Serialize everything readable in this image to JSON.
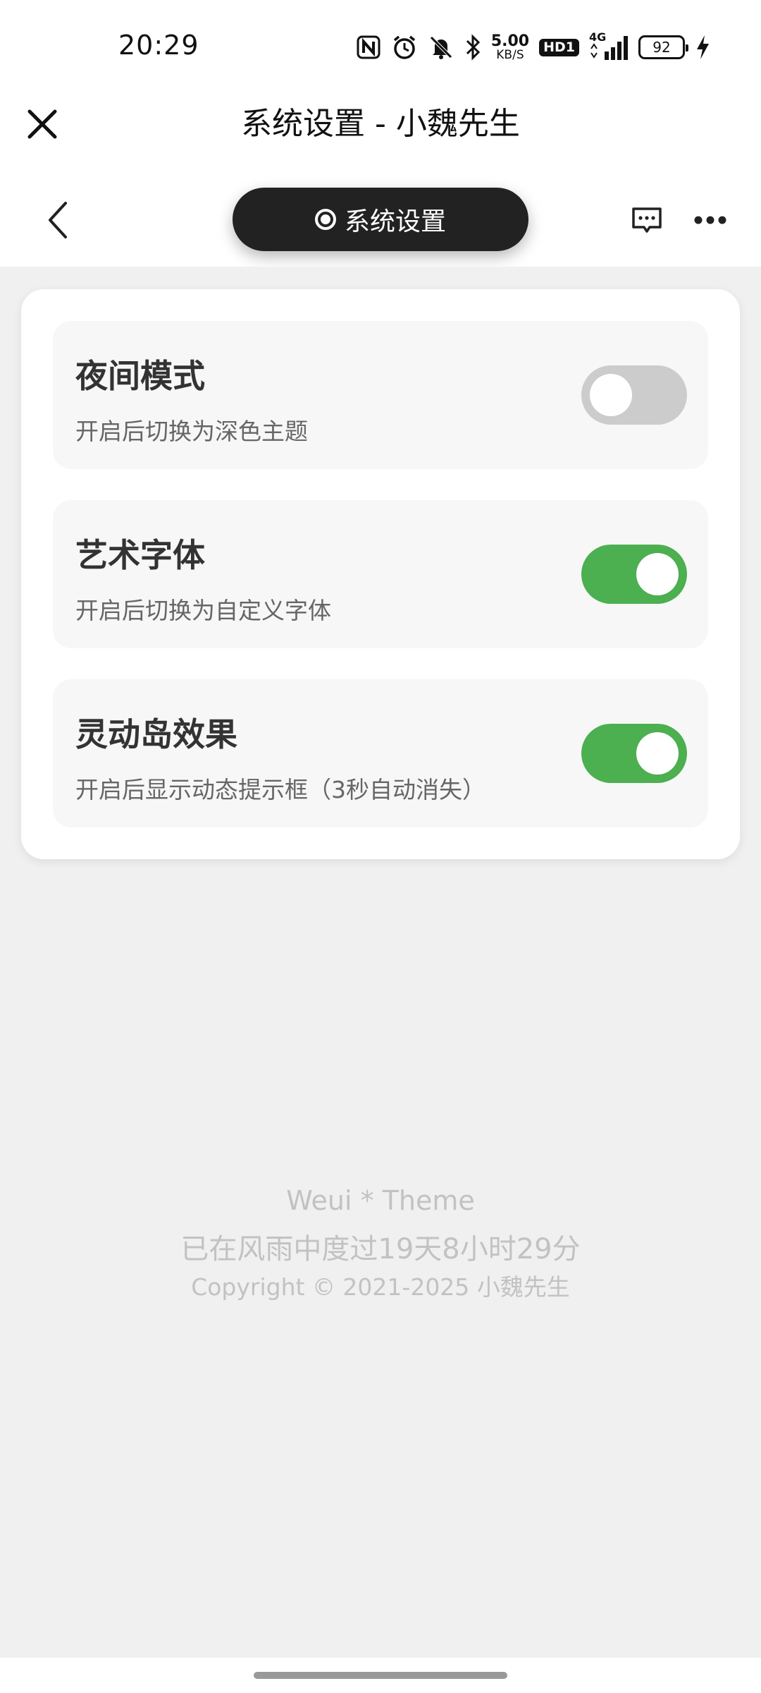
{
  "status_bar": {
    "time": "20:29",
    "net_speed_value": "5.00",
    "net_speed_unit": "KB/S",
    "hd_badge": "HD1",
    "network_type": "4G",
    "battery_level": "92",
    "icons": [
      "nfc-icon",
      "alarm-icon",
      "mute-icon",
      "bluetooth-icon",
      "signal-icon",
      "charging-icon"
    ]
  },
  "header": {
    "title": "系统设置 - 小魏先生"
  },
  "nav": {
    "pill_label": "系统设置"
  },
  "settings": [
    {
      "title": "夜间模式",
      "desc": "开启后切换为深色主题",
      "enabled": false
    },
    {
      "title": "艺术字体",
      "desc": "开启后切换为自定义字体",
      "enabled": true
    },
    {
      "title": "灵动岛效果",
      "desc": "开启后显示动态提示框（3秒自动消失）",
      "enabled": true
    }
  ],
  "footer": {
    "line1": "Weui * Theme",
    "line2": "已在风雨中度过19天8小时29分",
    "line3": "Copyright © 2021-2025 小魏先生"
  },
  "colors": {
    "toggle_on": "#4caf50",
    "toggle_off": "#cccccc",
    "pill_bg": "#222222",
    "content_bg": "#f0f0f0"
  }
}
